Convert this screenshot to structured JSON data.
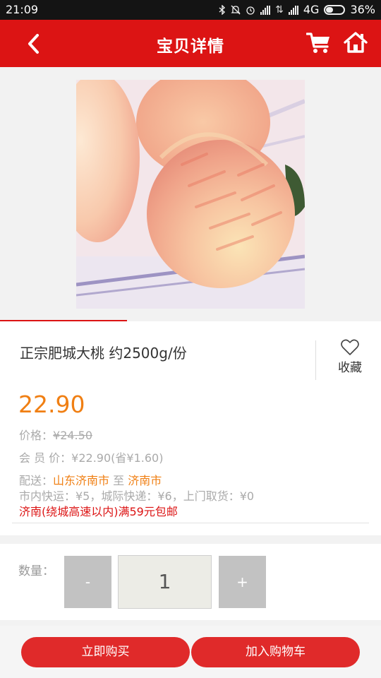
{
  "status_bar": {
    "time": "21:09",
    "network": "4G",
    "battery": "36%",
    "battery_level": 0.36,
    "icons": [
      "bluetooth-icon",
      "mute-icon",
      "alarm-icon",
      "signal-icon",
      "signal-icon"
    ]
  },
  "header": {
    "title": "宝贝详情",
    "back_icon": "chevron-left-icon",
    "cart_icon": "shopping-cart-icon",
    "home_icon": "home-icon",
    "color": "#dc1414"
  },
  "gallery": {
    "image_subject": "peach",
    "page": 1,
    "page_count": 3
  },
  "product": {
    "name": "正宗肥城大桃 约2500g/份",
    "price": "22.90",
    "original_price_label": "价格：",
    "original_price": "¥24.50",
    "member_price": "会 员 价：¥22.90(省¥1.60)",
    "delivery_label": "配送：",
    "delivery_from": "山东济南市",
    "delivery_to_word": " 至 ",
    "delivery_to": "济南市",
    "shipping_fees": "市内快运：¥5，城际快递：¥6，上门取货：¥0",
    "free_shipping": "济南(绕城高速以内)满59元包邮",
    "favorite_label": "收藏",
    "accent": "#f07f13"
  },
  "quantity": {
    "label": "数量：",
    "minus": "-",
    "value": "1",
    "plus": "+"
  },
  "actions": {
    "buy_now": "立即购买",
    "add_to_cart": "加入购物车",
    "color": "#e02a2a"
  }
}
